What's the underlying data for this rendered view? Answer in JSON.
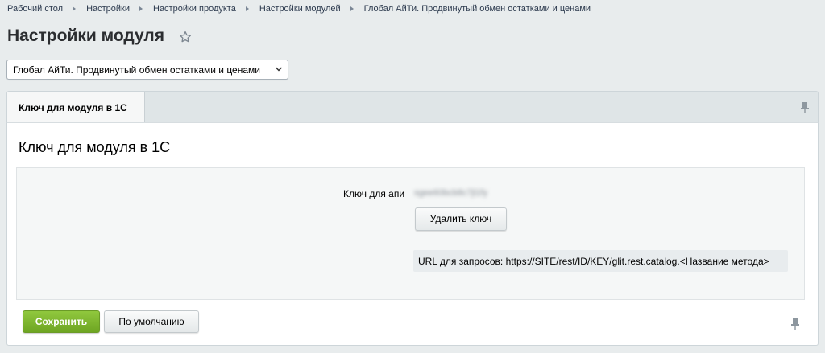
{
  "breadcrumb": {
    "items": [
      "Рабочий стол",
      "Настройки",
      "Настройки продукта",
      "Настройки модулей",
      "Глобал АйТи. Продвинутый обмен остатками и ценами"
    ]
  },
  "page": {
    "title": "Настройки модуля"
  },
  "module_select": {
    "value": "Глобал АйТи. Продвинутый обмен остатками и ценами"
  },
  "tabs": [
    {
      "label": "Ключ для модуля в 1С",
      "active": true
    }
  ],
  "panel": {
    "title": "Ключ для модуля в 1С",
    "key_label": "Ключ для апи",
    "key_value": "sgee60bcb8c7jl1fy",
    "delete_button": "Удалить ключ",
    "url_text": "URL для запросов: https://SITE/rest/ID/KEY/glit.rest.catalog.<Название метода>"
  },
  "footer": {
    "save_button": "Сохранить",
    "default_button": "По умолчанию"
  },
  "colors": {
    "accent_green": "#7cb32d",
    "background": "#e8eced"
  }
}
